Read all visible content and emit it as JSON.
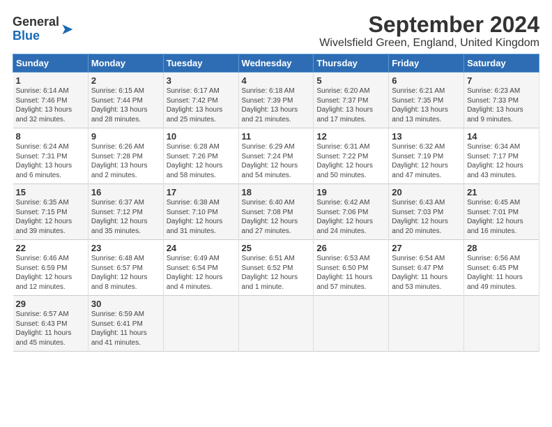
{
  "header": {
    "logo_general": "General",
    "logo_blue": "Blue",
    "title": "September 2024",
    "subtitle": "Wivelsfield Green, England, United Kingdom"
  },
  "days_of_week": [
    "Sunday",
    "Monday",
    "Tuesday",
    "Wednesday",
    "Thursday",
    "Friday",
    "Saturday"
  ],
  "weeks": [
    [
      {
        "day": "1",
        "sunrise": "6:14 AM",
        "sunset": "7:46 PM",
        "daylight": "13 hours and 32 minutes."
      },
      {
        "day": "2",
        "sunrise": "6:15 AM",
        "sunset": "7:44 PM",
        "daylight": "13 hours and 28 minutes."
      },
      {
        "day": "3",
        "sunrise": "6:17 AM",
        "sunset": "7:42 PM",
        "daylight": "13 hours and 25 minutes."
      },
      {
        "day": "4",
        "sunrise": "6:18 AM",
        "sunset": "7:39 PM",
        "daylight": "13 hours and 21 minutes."
      },
      {
        "day": "5",
        "sunrise": "6:20 AM",
        "sunset": "7:37 PM",
        "daylight": "13 hours and 17 minutes."
      },
      {
        "day": "6",
        "sunrise": "6:21 AM",
        "sunset": "7:35 PM",
        "daylight": "13 hours and 13 minutes."
      },
      {
        "day": "7",
        "sunrise": "6:23 AM",
        "sunset": "7:33 PM",
        "daylight": "13 hours and 9 minutes."
      }
    ],
    [
      {
        "day": "8",
        "sunrise": "6:24 AM",
        "sunset": "7:31 PM",
        "daylight": "13 hours and 6 minutes."
      },
      {
        "day": "9",
        "sunrise": "6:26 AM",
        "sunset": "7:28 PM",
        "daylight": "13 hours and 2 minutes."
      },
      {
        "day": "10",
        "sunrise": "6:28 AM",
        "sunset": "7:26 PM",
        "daylight": "12 hours and 58 minutes."
      },
      {
        "day": "11",
        "sunrise": "6:29 AM",
        "sunset": "7:24 PM",
        "daylight": "12 hours and 54 minutes."
      },
      {
        "day": "12",
        "sunrise": "6:31 AM",
        "sunset": "7:22 PM",
        "daylight": "12 hours and 50 minutes."
      },
      {
        "day": "13",
        "sunrise": "6:32 AM",
        "sunset": "7:19 PM",
        "daylight": "12 hours and 47 minutes."
      },
      {
        "day": "14",
        "sunrise": "6:34 AM",
        "sunset": "7:17 PM",
        "daylight": "12 hours and 43 minutes."
      }
    ],
    [
      {
        "day": "15",
        "sunrise": "6:35 AM",
        "sunset": "7:15 PM",
        "daylight": "12 hours and 39 minutes."
      },
      {
        "day": "16",
        "sunrise": "6:37 AM",
        "sunset": "7:12 PM",
        "daylight": "12 hours and 35 minutes."
      },
      {
        "day": "17",
        "sunrise": "6:38 AM",
        "sunset": "7:10 PM",
        "daylight": "12 hours and 31 minutes."
      },
      {
        "day": "18",
        "sunrise": "6:40 AM",
        "sunset": "7:08 PM",
        "daylight": "12 hours and 27 minutes."
      },
      {
        "day": "19",
        "sunrise": "6:42 AM",
        "sunset": "7:06 PM",
        "daylight": "12 hours and 24 minutes."
      },
      {
        "day": "20",
        "sunrise": "6:43 AM",
        "sunset": "7:03 PM",
        "daylight": "12 hours and 20 minutes."
      },
      {
        "day": "21",
        "sunrise": "6:45 AM",
        "sunset": "7:01 PM",
        "daylight": "12 hours and 16 minutes."
      }
    ],
    [
      {
        "day": "22",
        "sunrise": "6:46 AM",
        "sunset": "6:59 PM",
        "daylight": "12 hours and 12 minutes."
      },
      {
        "day": "23",
        "sunrise": "6:48 AM",
        "sunset": "6:57 PM",
        "daylight": "12 hours and 8 minutes."
      },
      {
        "day": "24",
        "sunrise": "6:49 AM",
        "sunset": "6:54 PM",
        "daylight": "12 hours and 4 minutes."
      },
      {
        "day": "25",
        "sunrise": "6:51 AM",
        "sunset": "6:52 PM",
        "daylight": "12 hours and 1 minute."
      },
      {
        "day": "26",
        "sunrise": "6:53 AM",
        "sunset": "6:50 PM",
        "daylight": "11 hours and 57 minutes."
      },
      {
        "day": "27",
        "sunrise": "6:54 AM",
        "sunset": "6:47 PM",
        "daylight": "11 hours and 53 minutes."
      },
      {
        "day": "28",
        "sunrise": "6:56 AM",
        "sunset": "6:45 PM",
        "daylight": "11 hours and 49 minutes."
      }
    ],
    [
      {
        "day": "29",
        "sunrise": "6:57 AM",
        "sunset": "6:43 PM",
        "daylight": "11 hours and 45 minutes."
      },
      {
        "day": "30",
        "sunrise": "6:59 AM",
        "sunset": "6:41 PM",
        "daylight": "11 hours and 41 minutes."
      },
      null,
      null,
      null,
      null,
      null
    ]
  ]
}
